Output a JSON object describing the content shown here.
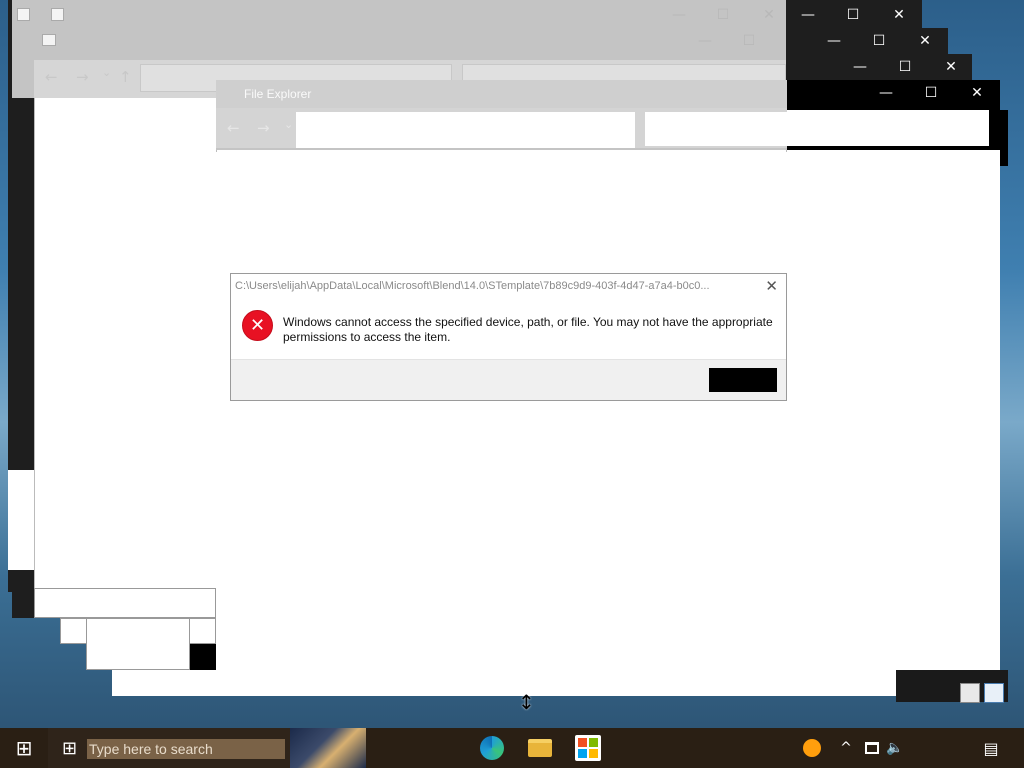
{
  "windows": {
    "explorer_title": "File Explorer",
    "min_glyph": "—",
    "max_glyph": "☐",
    "close_glyph": "✕",
    "back_glyph": "←",
    "forward_glyph": "→",
    "recent_glyph": "⌄",
    "up_glyph": "↑"
  },
  "dialog": {
    "path_title": "C:\\Users\\elijah\\AppData\\Local\\Microsoft\\Blend\\14.0\\STemplate\\7b89c9d9-403f-4d47-a7a4-b0c0...",
    "message": "Windows cannot access the specified device, path, or file. You may not have the appropriate permissions to access the item.",
    "close_glyph": "✕",
    "error_glyph": "✕",
    "ok_label": ""
  },
  "taskbar": {
    "start_glyph": "⊞",
    "search_placeholder": "Type here to search",
    "tray_chevron": "^",
    "notification_glyph": "▤",
    "resize_cursor": "↕",
    "colors": {
      "taskbar": "#2a1f14",
      "search_box": "#7a6247",
      "edge": "#1f9fd6",
      "folder": "#e8b43a",
      "store": "#f25022",
      "orange_dot": "#ff9e0d",
      "error_red": "#e81123"
    }
  }
}
